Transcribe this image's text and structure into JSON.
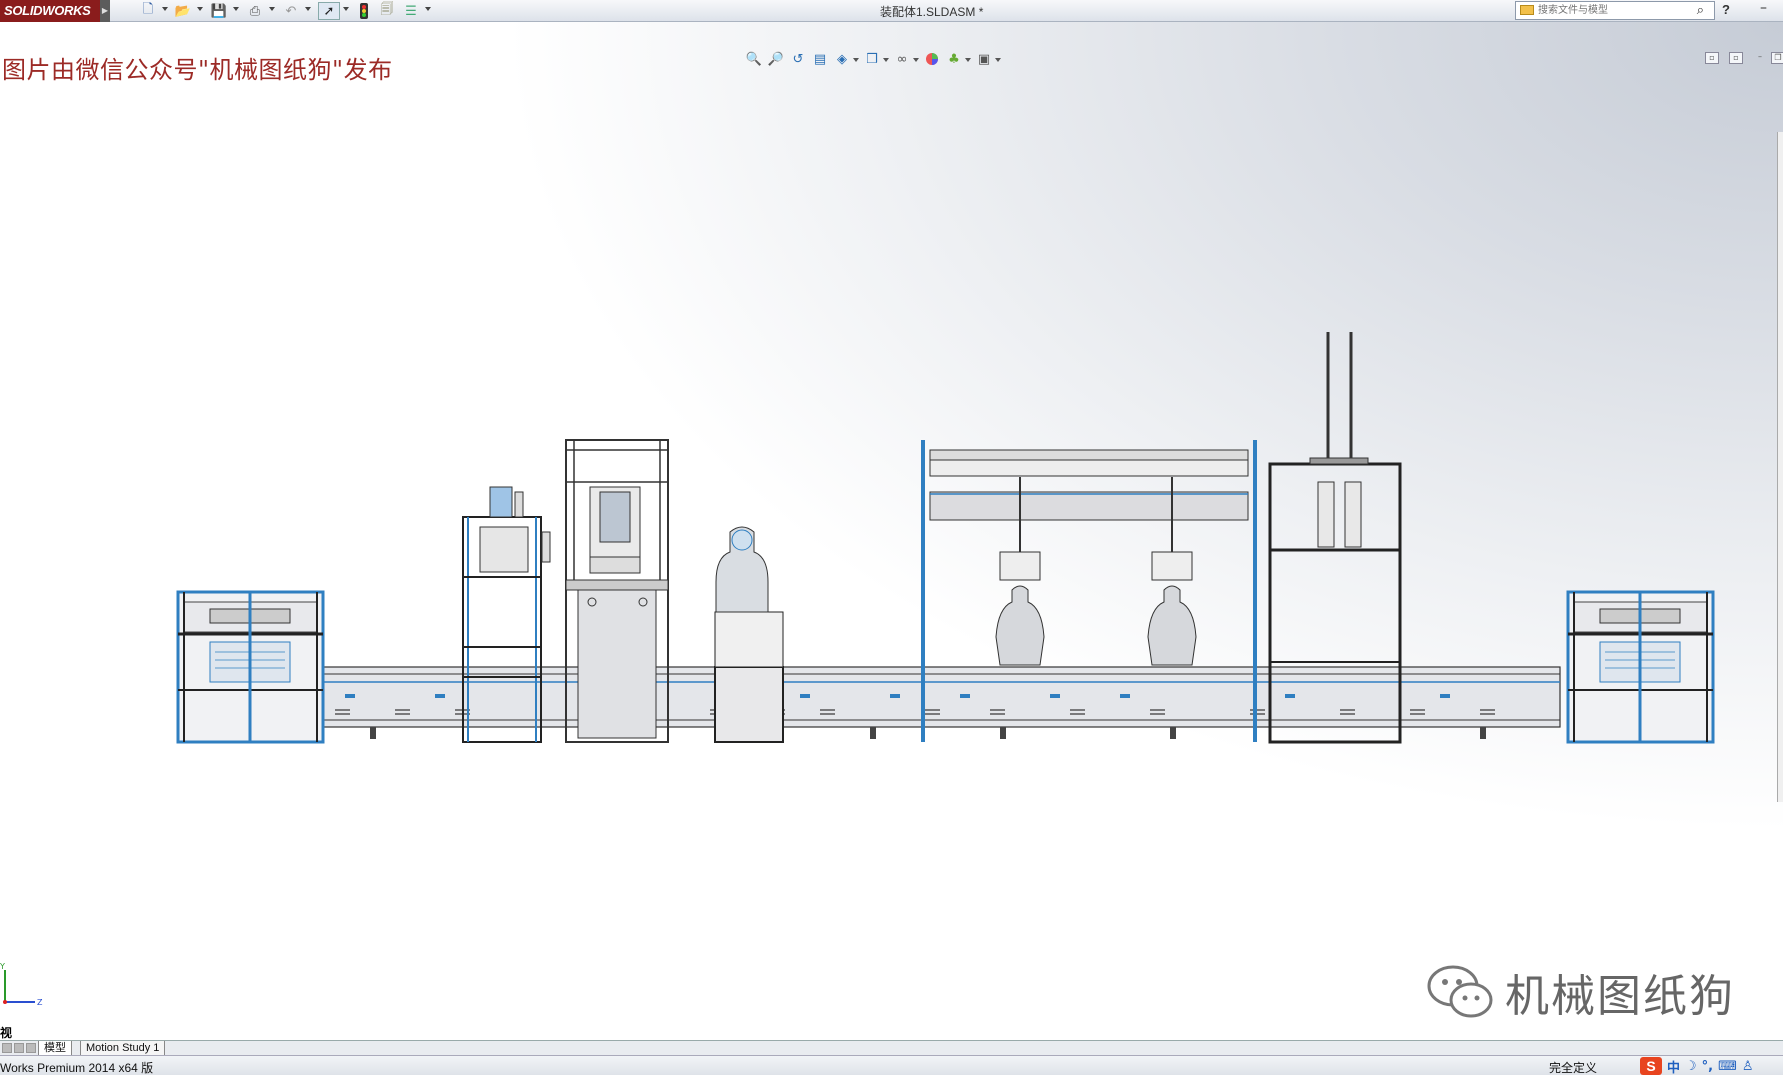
{
  "app": {
    "logo_text": "SOLIDWORKS",
    "document_title": "装配体1.SLDASM *"
  },
  "search": {
    "placeholder": "搜索文件与模型"
  },
  "toolbar": {
    "icons": [
      "new-document-icon",
      "open-folder-icon",
      "save-icon",
      "print-icon",
      "undo-icon",
      "select-arrow-icon",
      "rebuild-traffic-light-icon",
      "file-properties-icon",
      "options-list-icon"
    ]
  },
  "heads_up": {
    "icons": [
      "zoom-to-fit-icon",
      "zoom-to-area-icon",
      "previous-view-icon",
      "section-view-icon",
      "view-orientation-icon",
      "display-style-icon",
      "hide-show-icon",
      "edit-appearance-icon",
      "apply-scene-icon",
      "view-settings-icon"
    ]
  },
  "watermark": {
    "top_text": "图片由微信公众号\"机械图纸狗\"发布",
    "bottom_text": "机械图纸狗"
  },
  "triad": {
    "y_label": "Y",
    "z_label": "Z"
  },
  "view_label": "视",
  "tabs": [
    {
      "label": "模型",
      "active": true
    },
    {
      "label": "Motion Study 1",
      "active": false
    }
  ],
  "status": {
    "left_text": "Works Premium 2014 x64 版",
    "right_text": "完全定义"
  },
  "ime": {
    "logo": "S",
    "mode": "中"
  },
  "colors": {
    "logo_bg": "#8a1c1c",
    "watermark_red": "#9c2a26",
    "frame_blue": "#2f7fc1"
  }
}
